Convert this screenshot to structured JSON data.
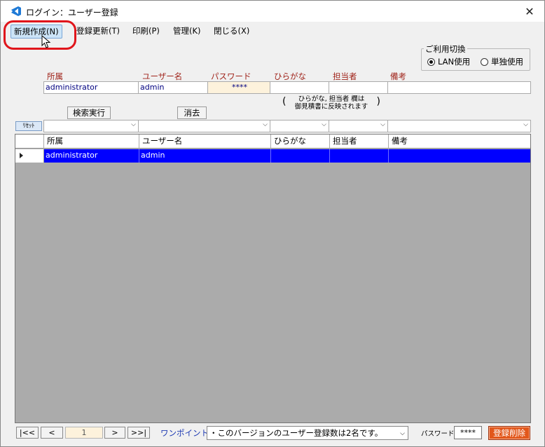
{
  "window": {
    "title": "ログイン：ユーザー登録",
    "close_label": "✕"
  },
  "menu": [
    {
      "label": "新規作成(N)"
    },
    {
      "label": "登録更新(T)"
    },
    {
      "label": "印刷(P)"
    },
    {
      "label": "管理(K)"
    },
    {
      "label": "閉じる(X)"
    }
  ],
  "usage": {
    "title": "ご利用切換",
    "options": [
      {
        "label": "LAN使用",
        "selected": true
      },
      {
        "label": "単独使用",
        "selected": false
      }
    ]
  },
  "form": {
    "headers": [
      "所属",
      "ユーザー名",
      "パスワード",
      "ひらがな",
      "担当者",
      "備考"
    ],
    "values": {
      "affiliation": "administrator",
      "username": "admin",
      "password": "****",
      "hiragana": "",
      "staff": "",
      "notes": ""
    },
    "note_line1": "ひらがな, 担当者 欄は",
    "note_line2": "御見積書に反映されます",
    "note_open": "(",
    "note_close": ")"
  },
  "buttons": {
    "search": "検索実行",
    "clear": "消去",
    "reset": "ﾘｾｯﾄ"
  },
  "grid": {
    "columns": [
      "所属",
      "ユーザー名",
      "ひらがな",
      "担当者",
      "備考"
    ],
    "rows": [
      {
        "affiliation": "administrator",
        "username": "admin",
        "hiragana": "",
        "staff": "",
        "notes": ""
      }
    ]
  },
  "footer": {
    "first": "|<<",
    "prev": "<",
    "page": "1",
    "next": ">",
    "last": ">>|",
    "onepoint_label": "ワンポイント:",
    "onepoint_text": "・このバージョンのユーザー登録数は2名です。",
    "password_label": "パスワード",
    "password_value": "****",
    "delete_label": "登録削除"
  },
  "colors": {
    "accent": "#0000ff",
    "highlight": "#e0151b",
    "delete": "#e2571b",
    "header_text": "#a0241b"
  }
}
